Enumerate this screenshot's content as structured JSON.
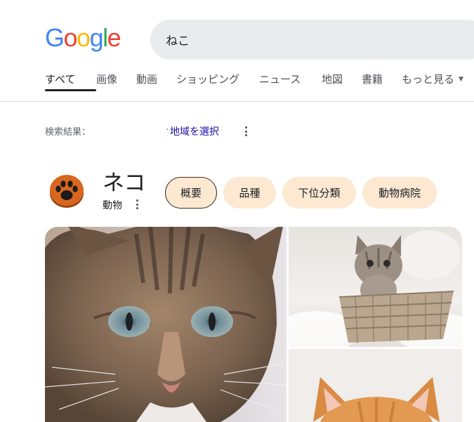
{
  "logo": {
    "letters": [
      "G",
      "o",
      "o",
      "g",
      "l",
      "e"
    ],
    "colors": [
      "#4285f4",
      "#ea4335",
      "#fbbc05",
      "#4285f4",
      "#34a853",
      "#ea4335"
    ]
  },
  "search": {
    "value": "ねこ"
  },
  "tabs": [
    {
      "label": "すべて",
      "active": true
    },
    {
      "label": "画像"
    },
    {
      "label": "動画"
    },
    {
      "label": "ショッピング"
    },
    {
      "label": "ニュース"
    },
    {
      "label": "地図"
    },
    {
      "label": "書籍"
    },
    {
      "label": "もっと見る"
    }
  ],
  "results_bar": {
    "label": "検索結果：",
    "region_link": "地域を選択"
  },
  "entity": {
    "title": "ネコ",
    "subtitle": "動物",
    "chips": [
      {
        "label": "概要",
        "active": true
      },
      {
        "label": "品種"
      },
      {
        "label": "下位分類"
      },
      {
        "label": "動物病院"
      }
    ]
  },
  "colors": {
    "chip_bg": "#fde8d2",
    "link": "#1a0dab",
    "icon_orange": "#d9661f"
  },
  "photos": [
    {
      "subject": "tabby-cat-closeup"
    },
    {
      "subject": "kitten-in-basket"
    },
    {
      "subject": "orange-cat"
    }
  ]
}
